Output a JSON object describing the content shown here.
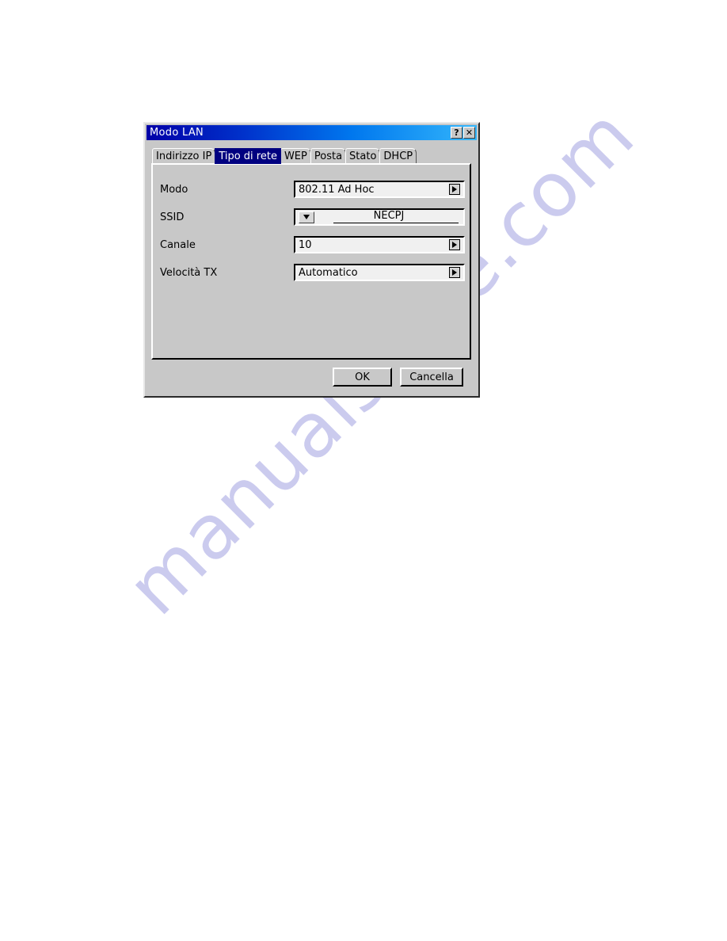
{
  "page": {
    "watermark": "manualshive.com",
    "background_color": "#ffffff"
  },
  "dialog": {
    "title": "Modo LAN",
    "titlebar": {
      "help_button": "?",
      "close_button": "✕",
      "gradient_start": "#0000a8",
      "gradient_end": "#33b6fb"
    },
    "face_color": "#c8c8c8",
    "tabs": [
      {
        "label": "Indirizzo IP",
        "selected": false
      },
      {
        "label": "Tipo di rete",
        "selected": true
      },
      {
        "label": "WEP",
        "selected": false
      },
      {
        "label": "Posta",
        "selected": false
      },
      {
        "label": "Stato",
        "selected": false
      },
      {
        "label": "DHCP",
        "selected": false
      }
    ],
    "selected_tab_color": "#000080",
    "fields": [
      {
        "label": "Modo",
        "value": "802.11 Ad Hoc",
        "control": "spinner-right"
      },
      {
        "label": "SSID",
        "value": "NECPJ",
        "control": "dropdown-text"
      },
      {
        "label": "Canale",
        "value": "10",
        "control": "spinner-right"
      },
      {
        "label": "Velocità TX",
        "value": "Automatico",
        "control": "spinner-right"
      }
    ],
    "buttons": {
      "ok": "OK",
      "cancel": "Cancella"
    }
  }
}
